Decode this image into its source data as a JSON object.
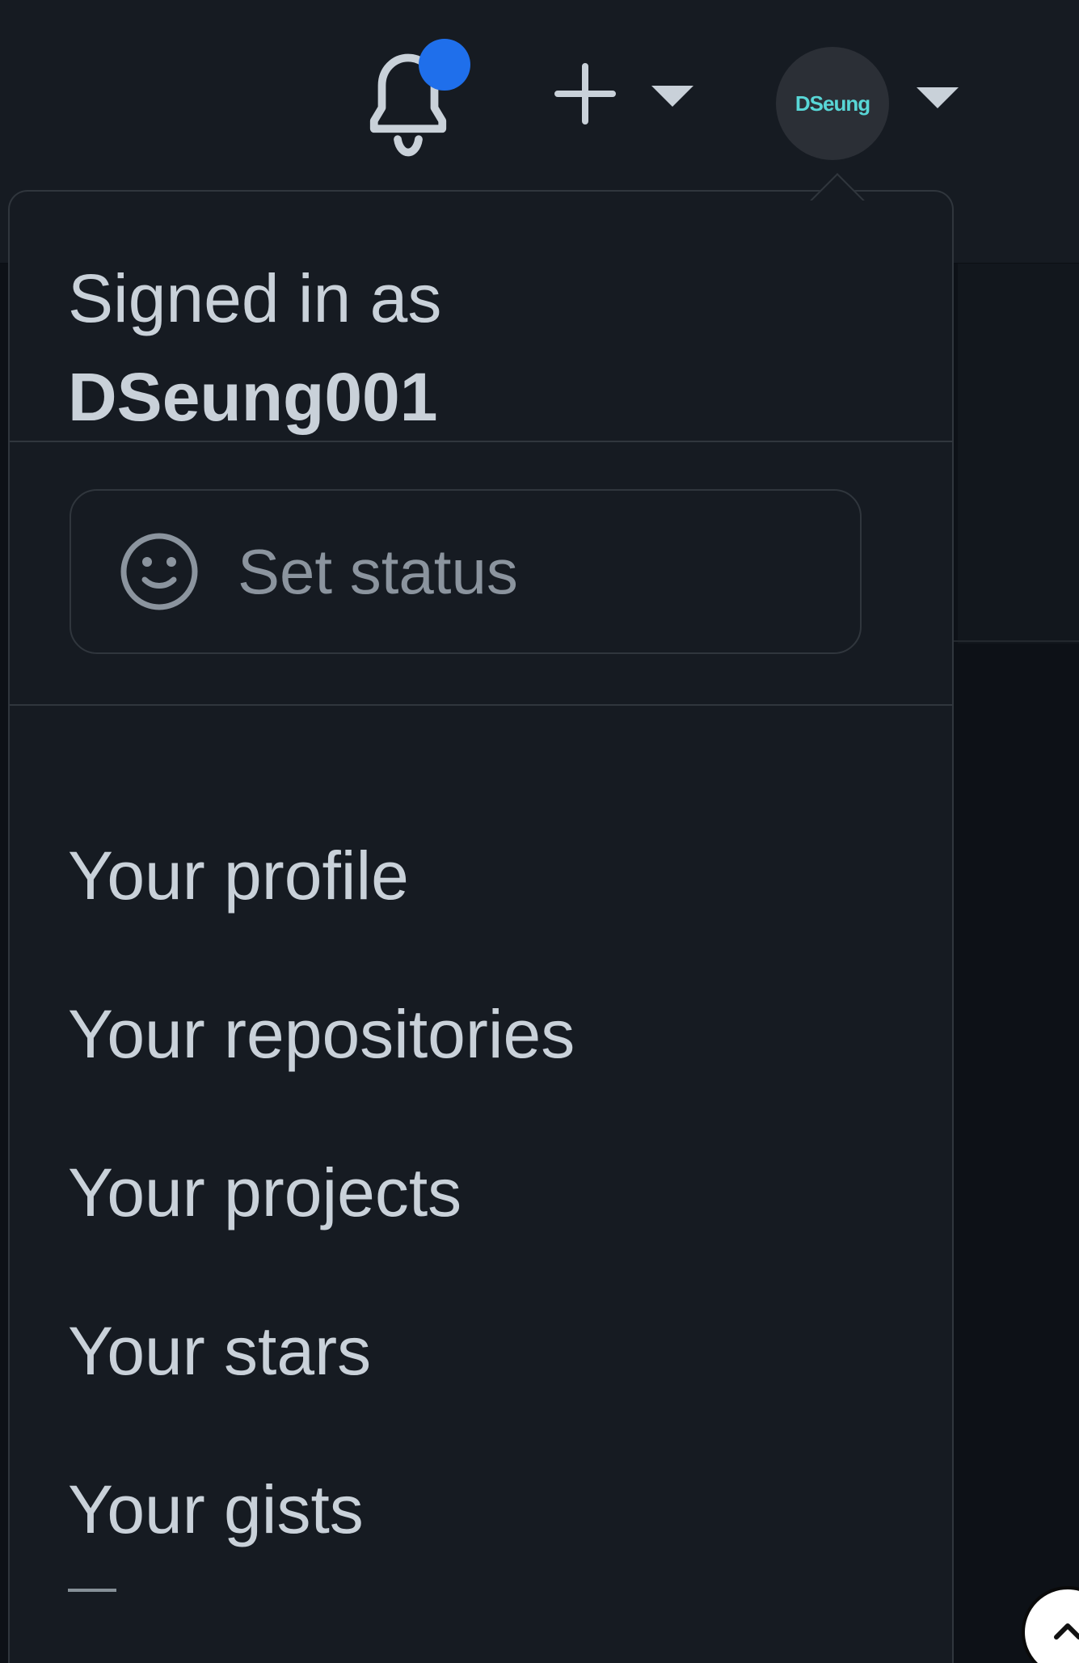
{
  "colors": {
    "background": "#0d1117",
    "panel": "#161b22",
    "text": "#c9d1d9",
    "muted": "#8b949e",
    "accent": "#1f6feb",
    "avatar_text": "#58d6d6"
  },
  "header": {
    "notification_icon": "bell-icon",
    "create_icon": "plus-icon",
    "create_caret_icon": "caret-down-icon",
    "avatar_label": "DSeung",
    "avatar_caret_icon": "caret-down-icon"
  },
  "dropdown": {
    "signed_in_label": "Signed in as",
    "username": "DSeung001",
    "status_button": {
      "icon": "smile-icon",
      "label": "Set status"
    },
    "items": [
      {
        "label": "Your profile"
      },
      {
        "label": "Your repositories"
      },
      {
        "label": "Your projects"
      },
      {
        "label": "Your stars"
      },
      {
        "label": "Your gists"
      }
    ]
  },
  "scroll_top_icon": "chevron-up-icon"
}
